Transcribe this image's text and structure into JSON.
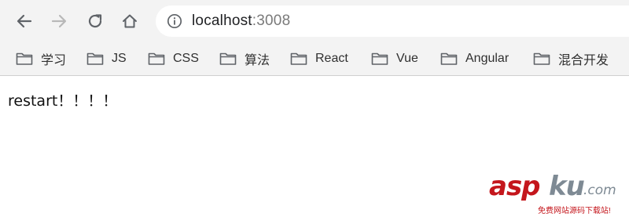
{
  "browser": {
    "address_bar": {
      "host": "localhost",
      "port": ":3008"
    },
    "bookmarks": [
      {
        "label": "学习"
      },
      {
        "label": "JS"
      },
      {
        "label": "CSS"
      },
      {
        "label": "算法"
      },
      {
        "label": "React"
      },
      {
        "label": "Vue"
      },
      {
        "label": "Angular"
      },
      {
        "label": "混合开发"
      }
    ],
    "icons": {
      "back": "arrow-left-icon",
      "forward": "arrow-right-icon",
      "reload": "reload-icon",
      "home": "home-icon",
      "info": "info-icon",
      "folder": "folder-icon"
    },
    "colors": {
      "chrome_bg": "#f3f3f3",
      "omnibox_bg": "#ffffff",
      "port_text": "#7a7a7a"
    }
  },
  "page": {
    "body_text": "restart！！！！"
  },
  "watermark": {
    "brand_asp": "asp",
    "brand_ku": "ku",
    "brand_tld": ".com",
    "tagline": "免费网站源码下载站!",
    "colors": {
      "red": "#c4161c",
      "gray": "#7e8a94"
    }
  }
}
